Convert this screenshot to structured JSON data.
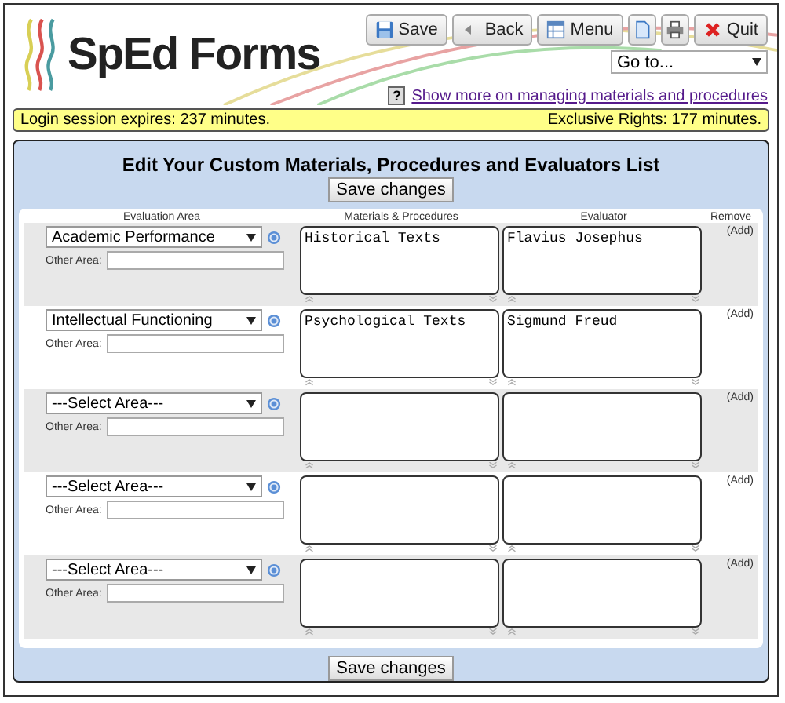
{
  "logo": {
    "text": "SpEd Forms"
  },
  "toolbar": [
    {
      "kind": "save",
      "label": "Save"
    },
    {
      "kind": "back",
      "label": "Back"
    },
    {
      "kind": "menu",
      "label": "Menu"
    },
    {
      "kind": "doc"
    },
    {
      "kind": "print"
    },
    {
      "kind": "quit",
      "label": "Quit"
    }
  ],
  "goto": {
    "value": "Go to..."
  },
  "help_icon": "?",
  "help_link": "Show more on managing materials and procedures",
  "status_bar": {
    "left": "Login session expires: 237 minutes.",
    "right": "Exclusive Rights: 177 minutes."
  },
  "title": "Edit Your Custom Materials, Procedures and Evaluators List",
  "save_top": "Save changes",
  "columns": [
    "Evaluation Area",
    "Materials & Procedures",
    "Evaluator",
    "Remove"
  ],
  "rows": [
    {
      "area": "Academic Performance",
      "other_label": "Other Area:",
      "materials": "Historical Texts",
      "evaluator": "Flavius Josephus",
      "action": "(Add)"
    },
    {
      "area": "Intellectual Functioning",
      "other_label": "Other Area:",
      "materials": "Psychological Texts",
      "evaluator": "Sigmund Freud",
      "action": "(Add)"
    },
    {
      "area": "---Select Area---",
      "other_label": "Other Area:",
      "materials": "",
      "evaluator": "",
      "action": "(Add)"
    },
    {
      "area": "---Select Area---",
      "other_label": "Other Area:",
      "materials": "",
      "evaluator": "",
      "action": "(Add)"
    },
    {
      "area": "---Select Area---",
      "other_label": "Other Area:",
      "materials": "",
      "evaluator": "",
      "action": "(Add)"
    }
  ],
  "save_bottom": "Save changes"
}
